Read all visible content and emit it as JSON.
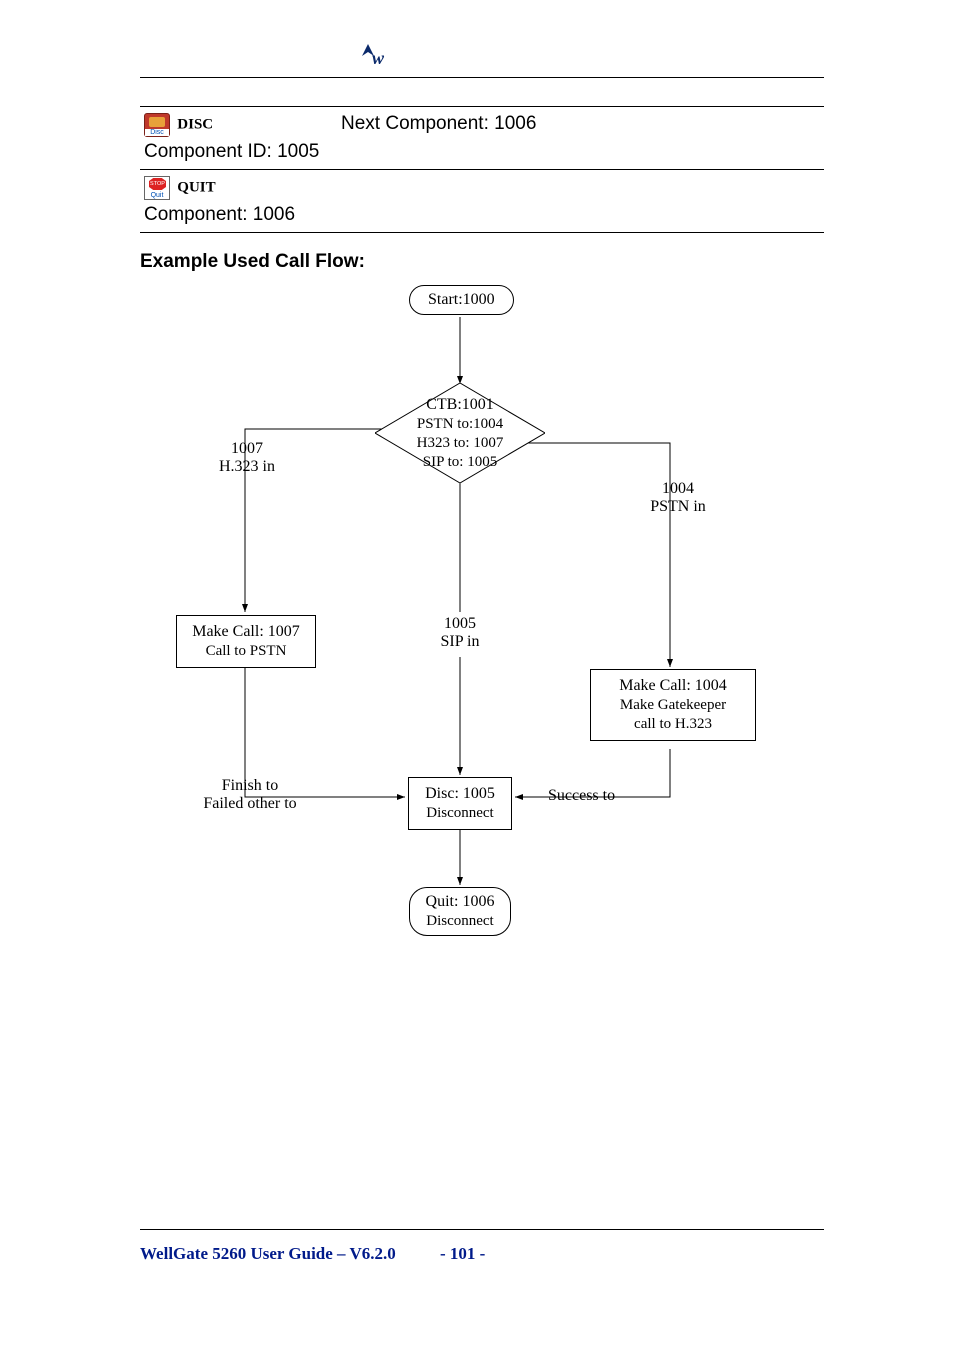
{
  "table": {
    "rows": [
      {
        "icon": "disc",
        "icon_label": "DISC",
        "subtext": "Component ID: 1005",
        "right": "Next Component: 1006"
      },
      {
        "icon": "quit",
        "icon_label": "QUIT",
        "subtext": "Component: 1006",
        "right": ""
      }
    ]
  },
  "section_title": "Example Used Call Flow:",
  "flow": {
    "start": "Start:1000",
    "ctb": {
      "title": "CTB:1001",
      "l1": "PSTN to:1004",
      "l2": "H323 to: 1007",
      "l3": "SIP to: 1005"
    },
    "branch_left": {
      "l1": "1007",
      "l2": "H.323 in"
    },
    "branch_right": {
      "l1": "1004",
      "l2": "PSTN in"
    },
    "make_1007": {
      "l1": "Make Call: 1007",
      "l2": "Call to PSTN"
    },
    "sip": {
      "l1": "1005",
      "l2": "SIP in"
    },
    "make_1004": {
      "l1": "Make Call: 1004",
      "l2": "Make Gatekeeper",
      "l3": "call to H.323"
    },
    "finish": {
      "l1": "Finish to",
      "l2": "Failed other to"
    },
    "disc": {
      "l1": "Disc: 1005",
      "l2": "Disconnect"
    },
    "success": "Success to",
    "quit": {
      "l1": "Quit: 1006",
      "l2": "Disconnect"
    }
  },
  "footer": {
    "title": "WellGate 5260 User Guide – V6.2.0",
    "page": "- 101 -"
  },
  "chart_data": {
    "type": "flowchart",
    "nodes": [
      {
        "id": "1000",
        "label": "Start:1000",
        "shape": "terminator"
      },
      {
        "id": "1001",
        "label": "CTB:1001",
        "shape": "decision",
        "details": [
          "PSTN to:1004",
          "H323 to: 1007",
          "SIP to: 1005"
        ]
      },
      {
        "id": "1007",
        "label": "Make Call: 1007",
        "shape": "process",
        "details": [
          "Call to PSTN"
        ]
      },
      {
        "id": "1004",
        "label": "Make Call: 1004",
        "shape": "process",
        "details": [
          "Make Gatekeeper",
          "call to H.323"
        ]
      },
      {
        "id": "1005",
        "label": "Disc: 1005",
        "shape": "process",
        "details": [
          "Disconnect"
        ]
      },
      {
        "id": "1006",
        "label": "Quit: 1006",
        "shape": "terminator",
        "details": [
          "Disconnect"
        ]
      }
    ],
    "edges": [
      {
        "from": "1000",
        "to": "1001"
      },
      {
        "from": "1001",
        "to": "1007",
        "label": "1007 H.323 in"
      },
      {
        "from": "1001",
        "to": "1004",
        "label": "1004 PSTN in"
      },
      {
        "from": "1001",
        "to": "1005",
        "label": "1005 SIP in"
      },
      {
        "from": "1007",
        "to": "1005",
        "label": "Finish to / Failed other to"
      },
      {
        "from": "1004",
        "to": "1005",
        "label": "Success to"
      },
      {
        "from": "1005",
        "to": "1006"
      }
    ]
  }
}
